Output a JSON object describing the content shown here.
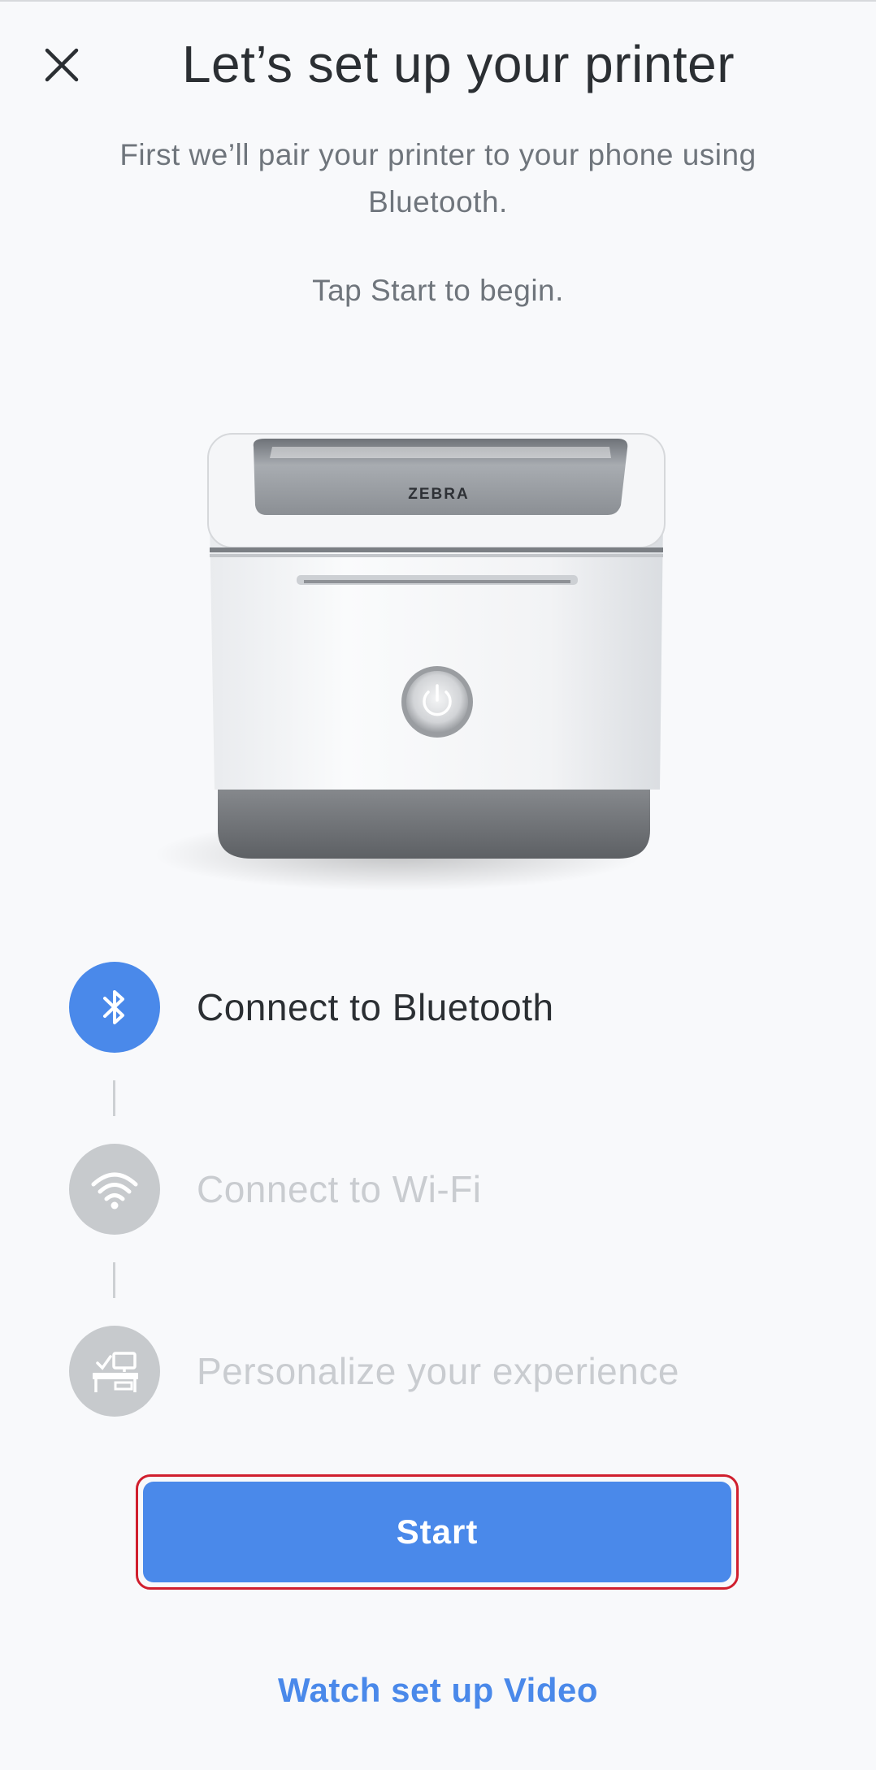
{
  "header": {
    "title": "Let’s set up your printer",
    "close_icon": "close-icon"
  },
  "intro": {
    "line": "First we’ll pair your printer to your phone using Bluetooth.",
    "instruction": "Tap Start to begin."
  },
  "printer": {
    "brand": "ZEBRA"
  },
  "steps": [
    {
      "label": "Connect to Bluetooth",
      "icon": "bluetooth-icon",
      "state": "active"
    },
    {
      "label": "Connect to Wi-Fi",
      "icon": "wifi-icon",
      "state": "inactive"
    },
    {
      "label": "Personalize your experience",
      "icon": "desk-icon",
      "state": "inactive"
    }
  ],
  "actions": {
    "start_label": "Start",
    "video_label": "Watch set up Video"
  },
  "colors": {
    "accent": "#4a89ea",
    "inactive_icon": "#c7cacd",
    "highlight_border": "#d01f2e"
  }
}
